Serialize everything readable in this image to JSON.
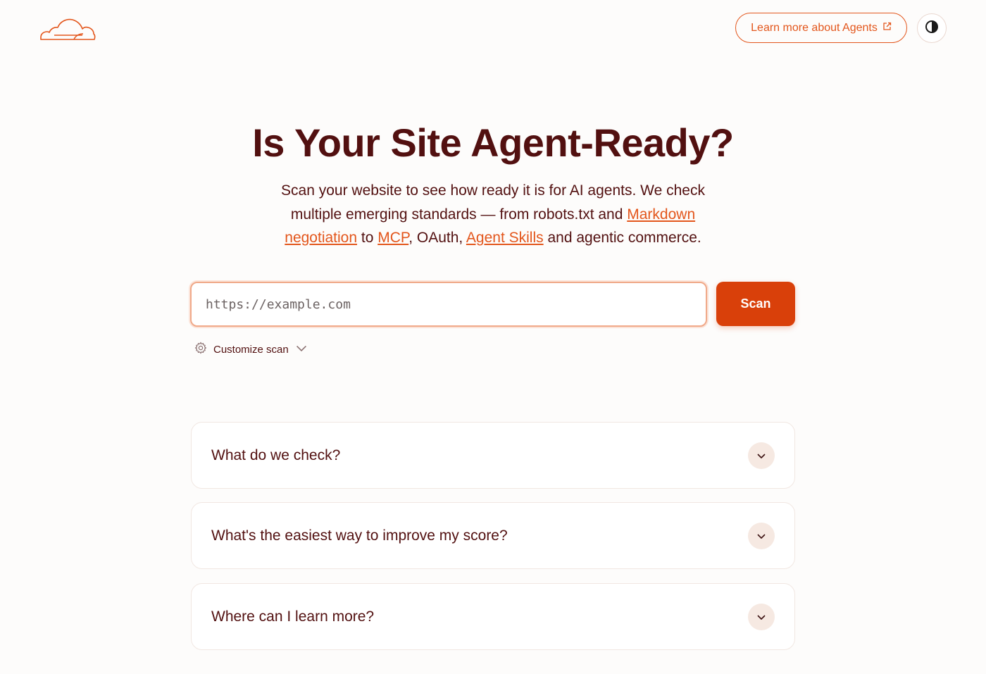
{
  "header": {
    "logo_icon": "cloudflare-cloud-logo",
    "learn_more_label": "Learn more about Agents",
    "learn_more_icon": "external-link-icon",
    "theme_icon": "contrast-icon"
  },
  "hero": {
    "title": "Is Your Site Agent-Ready?",
    "subtitle_part1": "Scan your website to see how ready it is for AI agents. We check multiple emerging standards — from robots.txt and ",
    "link_markdown": "Markdown negotiation",
    "subtitle_part2": " to ",
    "link_mcp": "MCP",
    "subtitle_part3": ", OAuth, ",
    "link_agent_skills": "Agent Skills",
    "subtitle_part4": " and agentic commerce."
  },
  "scan": {
    "placeholder": "https://example.com",
    "button_label": "Scan",
    "customize_label": "Customize scan"
  },
  "faq": [
    {
      "question": "What do we check?"
    },
    {
      "question": "What's the easiest way to improve my score?"
    },
    {
      "question": "Where can I learn more?"
    }
  ],
  "colors": {
    "accent": "#e3561c",
    "button": "#d9400a",
    "text": "#521010",
    "background": "#fdfcfb"
  }
}
